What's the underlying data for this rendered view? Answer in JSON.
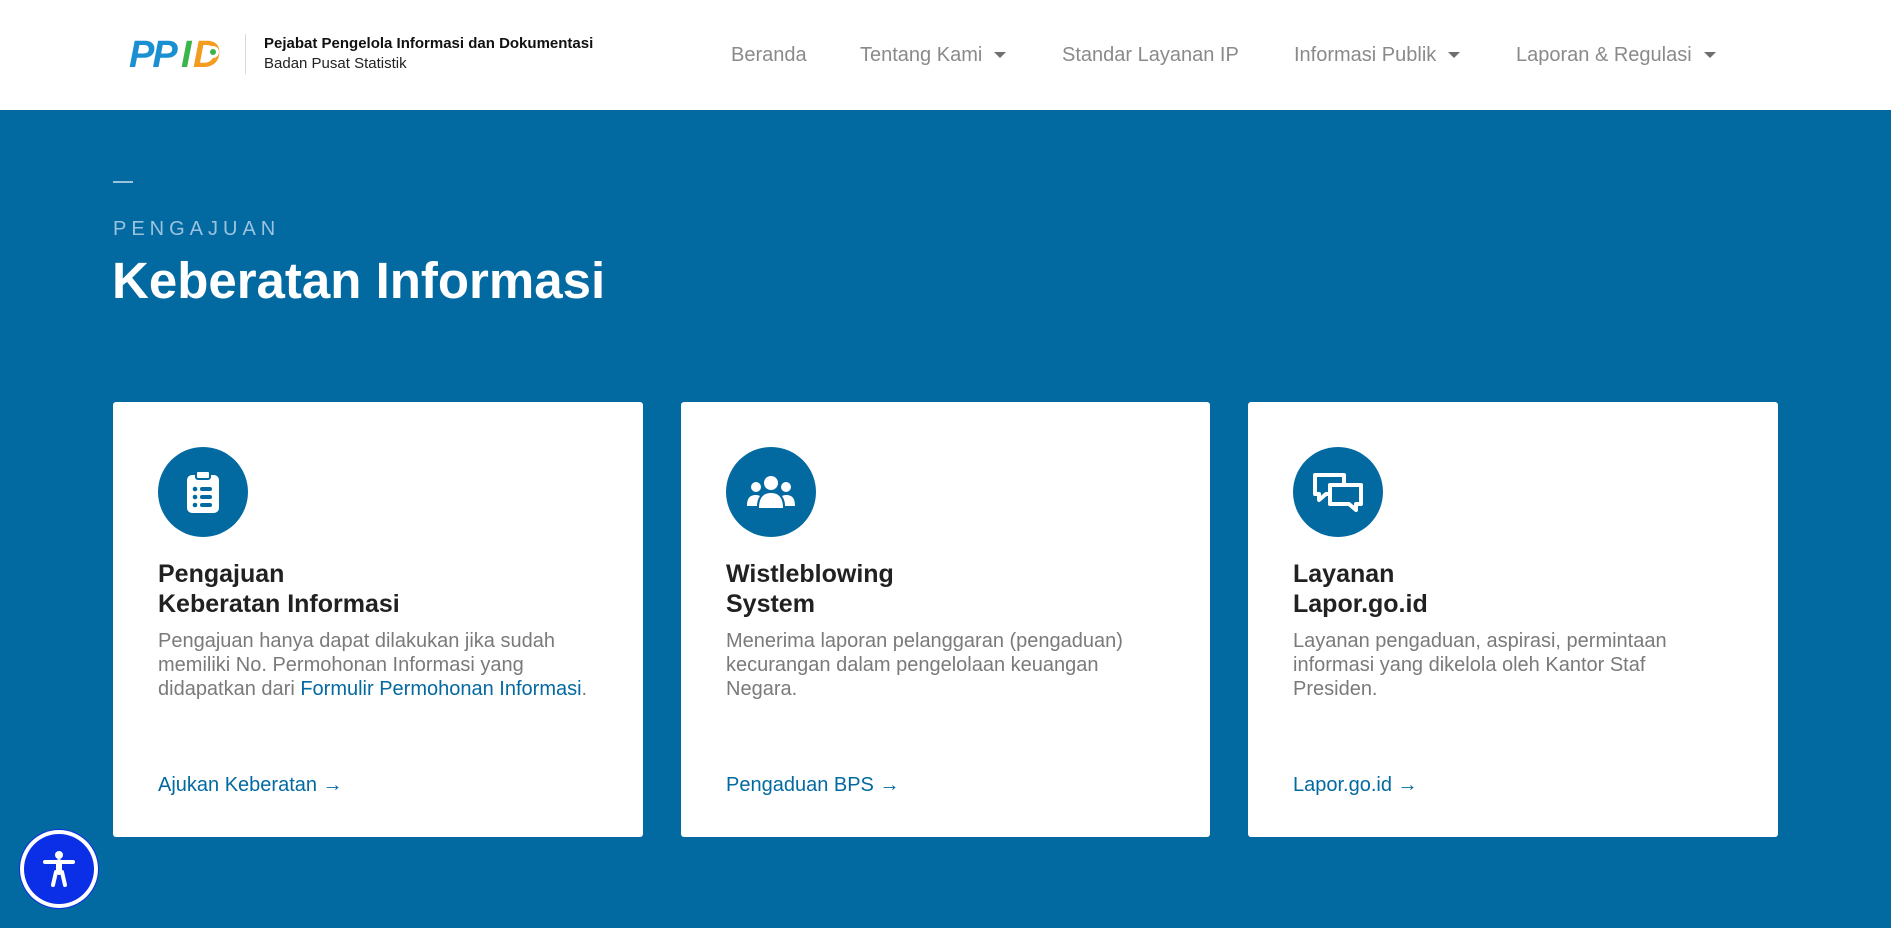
{
  "header": {
    "logo_text": "PPID",
    "brand_title": "Pejabat Pengelola Informasi dan Dokumentasi",
    "brand_subtitle": "Badan Pusat Statistik"
  },
  "nav": {
    "items": [
      {
        "label": "Beranda",
        "dropdown": false
      },
      {
        "label": "Tentang Kami",
        "dropdown": true
      },
      {
        "label": "Standar Layanan IP",
        "dropdown": false
      },
      {
        "label": "Informasi Publik",
        "dropdown": true
      },
      {
        "label": "Laporan & Regulasi",
        "dropdown": true
      }
    ]
  },
  "hero": {
    "eyebrow": "PENGAJUAN",
    "title": "Keberatan Informasi"
  },
  "cards": [
    {
      "icon": "clipboard-list-icon",
      "title_line1": "Pengajuan",
      "title_line2": "Keberatan Informasi",
      "desc": "Pengajuan hanya dapat dilakukan jika sudah memiliki No. Permohonan Informasi yang didapatkan dari ",
      "desc_link": "Formulir Permohonan Informasi",
      "desc_end": ".",
      "link": "Ajukan Keberatan →"
    },
    {
      "icon": "users-icon",
      "title_line1": "Wistleblowing",
      "title_line2": "System",
      "desc": "Menerima laporan pelanggaran (pengaduan) kecurangan dalam pengelolaan keuangan Negara.",
      "link": "Pengaduan BPS →"
    },
    {
      "icon": "chat-bubbles-icon",
      "title_line1": "Layanan",
      "title_line2": "Lapor.go.id",
      "desc": "Layanan pengaduan, aspirasi, permintaan informasi yang dikelola oleh Kantor Staf Presiden.",
      "link": "Lapor.go.id →"
    }
  ],
  "accessibility": {
    "icon": "accessibility-icon"
  },
  "colors": {
    "primary": "#0369a1",
    "nav_text": "#8a8a8a",
    "accessibility_button": "#0b2fe6"
  }
}
